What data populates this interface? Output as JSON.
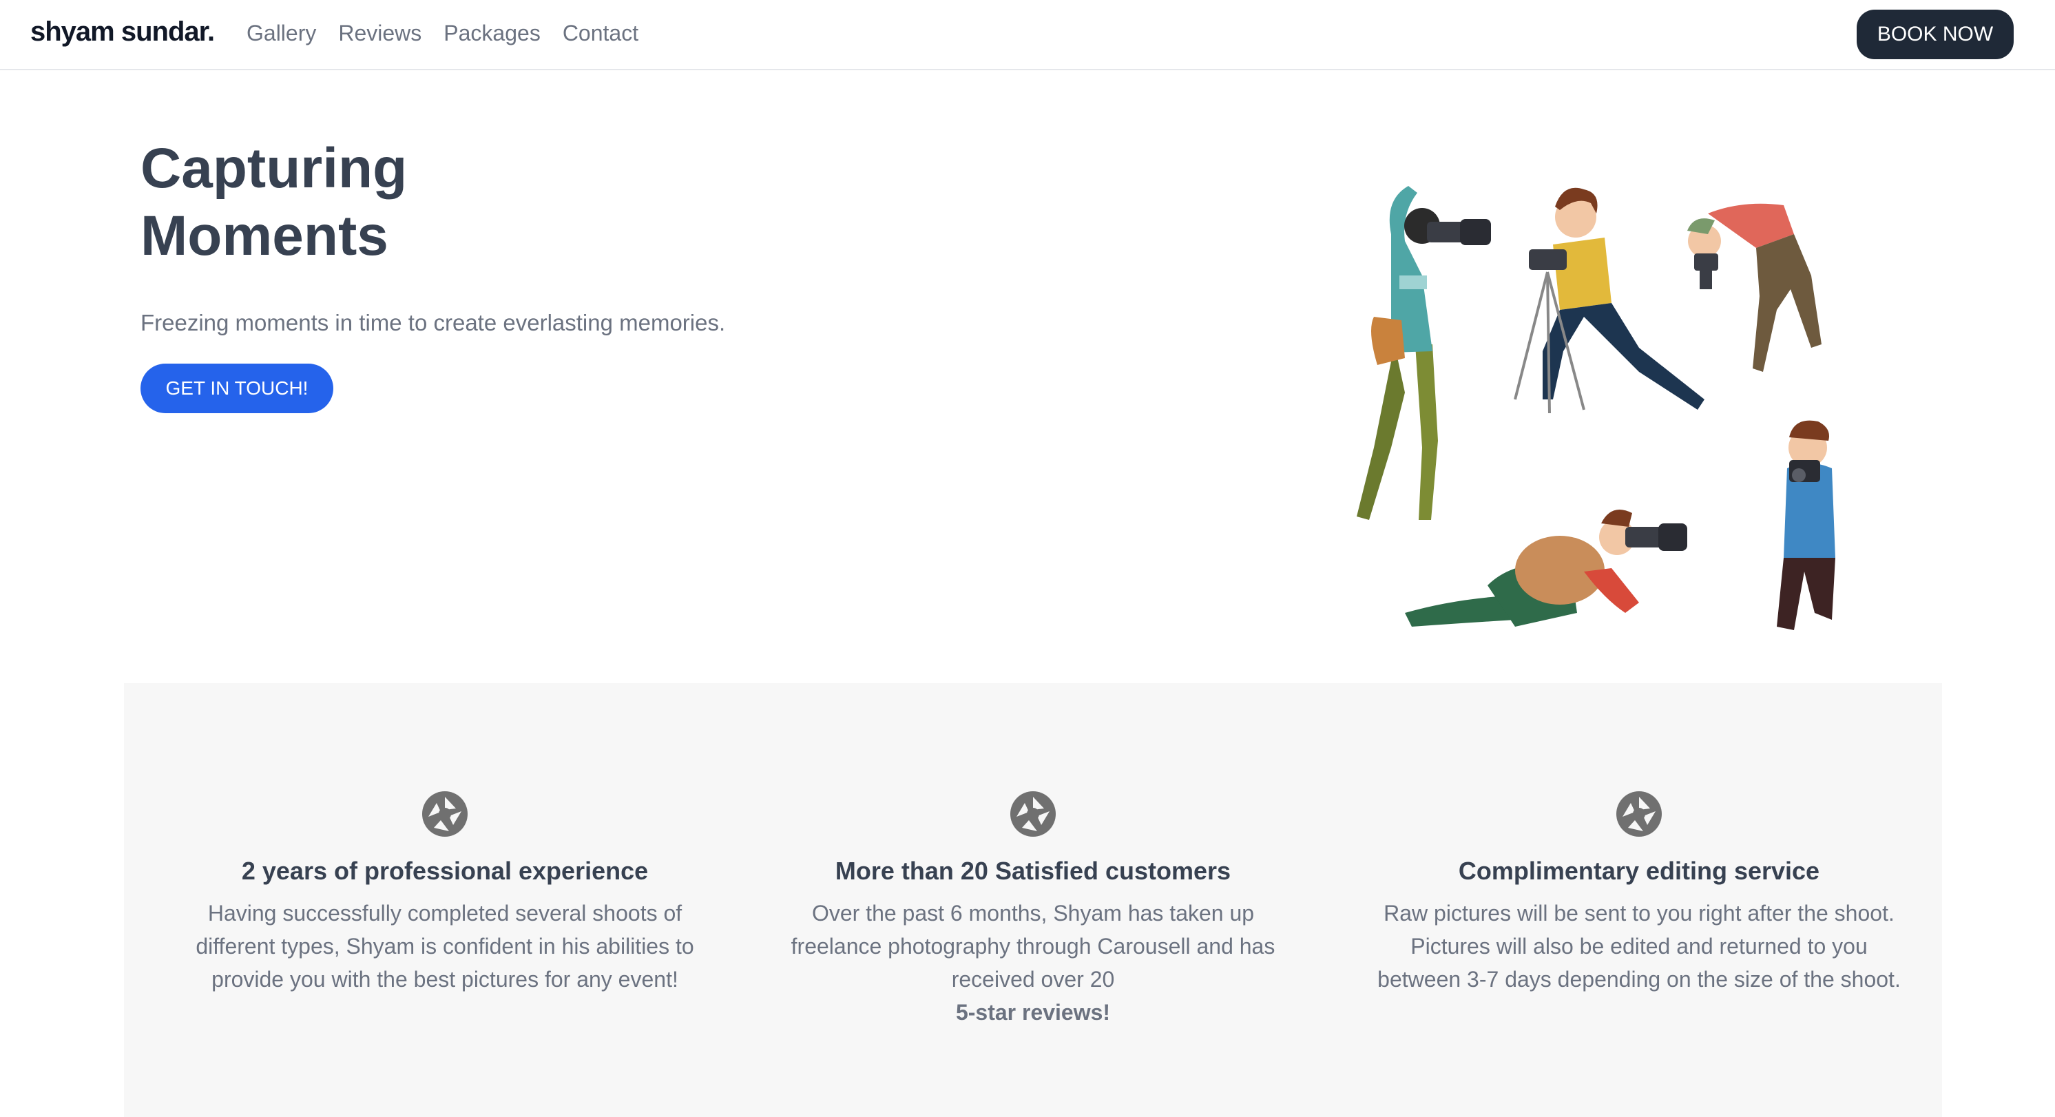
{
  "nav": {
    "brand": "shyam sundar.",
    "links": [
      "Gallery",
      "Reviews",
      "Packages",
      "Contact"
    ],
    "book_label": "BOOK NOW"
  },
  "hero": {
    "title_line1": "Capturing",
    "title_line2": "Moments",
    "subtitle": "Freezing moments in time to create everlasting memories.",
    "cta_label": "GET IN TOUCH!"
  },
  "features": [
    {
      "icon": "camera-aperture-icon",
      "title": "2 years of professional experience",
      "text": "Having successfully completed several shoots of different types, Shyam is confident in his abilities to provide you with the best pictures for any event!"
    },
    {
      "icon": "camera-aperture-icon",
      "title": "More than 20 Satisfied customers",
      "text": "Over the past 6 months, Shyam has taken up freelance photography through Carousell and has received over 20",
      "emphasis": "5-star reviews!"
    },
    {
      "icon": "camera-aperture-icon",
      "title": "Complimentary editing service",
      "text": "Raw pictures will be sent to you right after the shoot. Pictures will also be edited and returned to you between 3-7 days depending on the size of the shoot."
    }
  ],
  "colors": {
    "primary": "#2563eb",
    "dark_button": "#1f2937",
    "heading": "#374151",
    "muted_text": "#6b7280",
    "feature_bg": "#f7f7f7"
  }
}
